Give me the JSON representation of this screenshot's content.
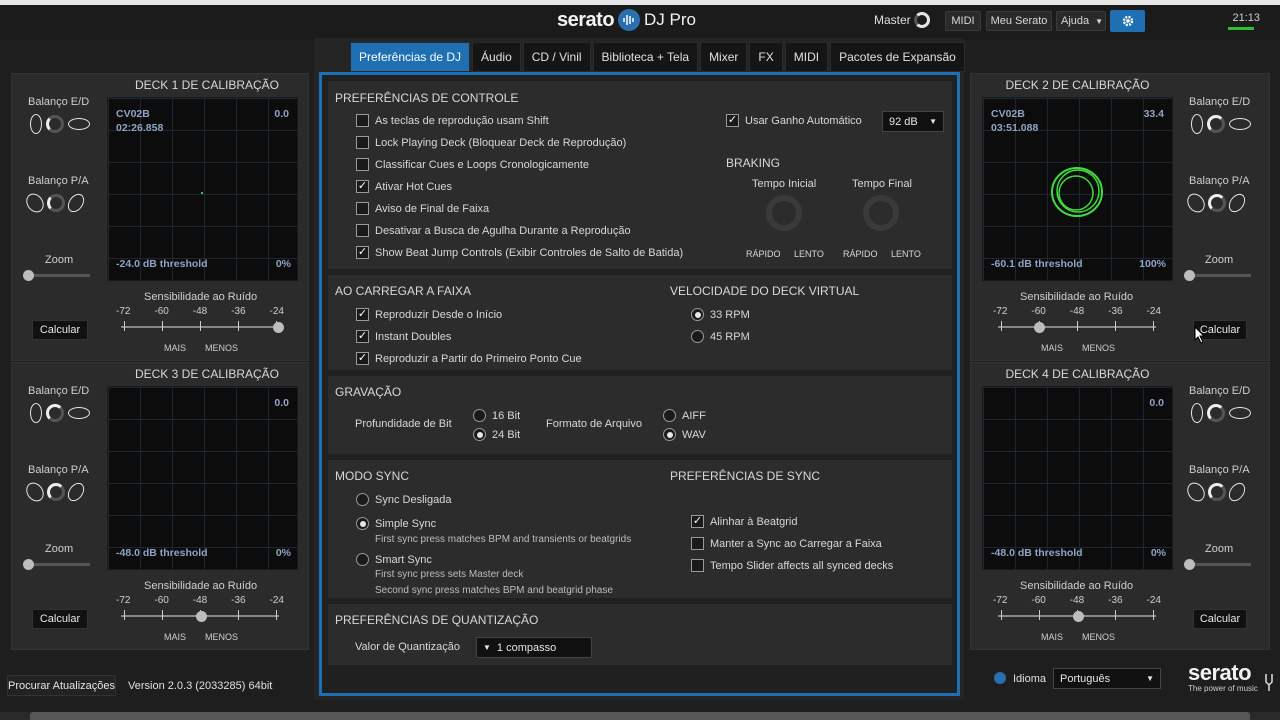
{
  "header": {
    "logo_word": "serato",
    "logo_sub": "DJ Pro",
    "master_label": "Master",
    "midi_button": "MIDI",
    "my_serato_button": "Meu Serato",
    "help_button": "Ajuda",
    "clock": "21:13"
  },
  "tabs": [
    {
      "label": "Preferências de DJ",
      "active": true
    },
    {
      "label": "Áudio"
    },
    {
      "label": "CD / Vinil"
    },
    {
      "label": "Biblioteca + Tela"
    },
    {
      "label": "Mixer"
    },
    {
      "label": "FX"
    },
    {
      "label": "MIDI"
    },
    {
      "label": "Pacotes de Expansão"
    }
  ],
  "decks": {
    "d1": {
      "title": "DECK 1 DE CALIBRAÇÃO",
      "track": "CV02B",
      "time": "02:26.858",
      "value": "0.0",
      "threshold": "-24.0 dB threshold",
      "percent": "0%",
      "noise_level": -24
    },
    "d2": {
      "title": "DECK 2 DE CALIBRAÇÃO",
      "track": "CV02B",
      "time": "03:51.088",
      "value": "33.4",
      "threshold": "-60.1 dB threshold",
      "percent": "100%",
      "noise_level": -60
    },
    "d3": {
      "title": "DECK 3 DE CALIBRAÇÃO",
      "value": "0.0",
      "threshold": "-48.0 dB threshold",
      "percent": "0%",
      "noise_level": -48
    },
    "d4": {
      "title": "DECK 4 DE CALIBRAÇÃO",
      "value": "0.0",
      "threshold": "-48.0 dB threshold",
      "percent": "0%",
      "noise_level": -48
    }
  },
  "deck_labels": {
    "balance_lr": "Balanço E/D",
    "balance_pa": "Balanço P/A",
    "zoom": "Zoom",
    "noise": "Sensibilidade ao Ruído",
    "calc": "Calcular",
    "more": "MAIS",
    "less": "MENOS",
    "ticks": [
      "-72",
      "-60",
      "-48",
      "-36",
      "-24"
    ]
  },
  "control": {
    "title": "PREFERÊNCIAS DE CONTROLE",
    "items": [
      {
        "label": "As teclas de reprodução usam Shift",
        "checked": false
      },
      {
        "label": "Lock Playing Deck (Bloquear Deck de Reprodução)",
        "checked": false
      },
      {
        "label": "Classificar Cues e Loops Cronologicamente",
        "checked": false
      },
      {
        "label": "Ativar Hot Cues",
        "checked": true
      },
      {
        "label": "Aviso de Final de Faixa",
        "checked": false
      },
      {
        "label": "Desativar a Busca de Agulha Durante a Reprodução",
        "checked": false
      },
      {
        "label": "Show Beat Jump Controls (Exibir Controles de Salto de Batida)",
        "checked": true
      }
    ],
    "auto_gain_label": "Usar Ganho Automático",
    "auto_gain_checked": true,
    "auto_gain_value": "92 dB",
    "braking_title": "BRAKING",
    "brake_start": "Tempo Inicial",
    "brake_end": "Tempo Final",
    "fast": "RÁPIDO",
    "slow": "LENTO"
  },
  "load": {
    "title": "AO CARREGAR A FAIXA",
    "items": [
      {
        "label": "Reproduzir Desde o Início",
        "checked": true
      },
      {
        "label": "Instant Doubles",
        "checked": true
      },
      {
        "label": "Reproduzir a Partir do Primeiro Ponto Cue",
        "checked": true
      }
    ],
    "virtual_title": "VELOCIDADE DO DECK VIRTUAL",
    "rpm": [
      {
        "label": "33 RPM",
        "selected": true
      },
      {
        "label": "45 RPM",
        "selected": false
      }
    ]
  },
  "recording": {
    "title": "GRAVAÇÃO",
    "bit_depth_label": "Profundidade de Bit",
    "bits": [
      {
        "label": "16 Bit",
        "selected": false
      },
      {
        "label": "24 Bit",
        "selected": true
      }
    ],
    "format_label": "Formato de Arquivo",
    "formats": [
      {
        "label": "AIFF",
        "selected": false
      },
      {
        "label": "WAV",
        "selected": true
      }
    ]
  },
  "sync": {
    "title": "MODO SYNC",
    "modes": [
      {
        "label": "Sync Desligada",
        "selected": false
      },
      {
        "label": "Simple Sync",
        "selected": true,
        "note1": "First sync press matches BPM and transients or beatgrids"
      },
      {
        "label": "Smart Sync",
        "selected": false,
        "note1": "First sync press sets Master deck",
        "note2": "Second sync press matches BPM and beatgrid phase"
      }
    ],
    "pref_title": "PREFERÊNCIAS DE SYNC",
    "prefs": [
      {
        "label": "Alinhar à Beatgrid",
        "checked": true
      },
      {
        "label": "Manter a Sync ao Carregar a Faixa",
        "checked": false
      },
      {
        "label": "Tempo Slider affects all synced decks",
        "checked": false
      }
    ]
  },
  "quant": {
    "title": "PREFERÊNCIAS DE QUANTIZAÇÃO",
    "label": "Valor de Quantização",
    "value": "1 compasso"
  },
  "footer": {
    "update_button": "Procurar Atualizações",
    "version": "Version 2.0.3 (2033285) 64bit",
    "language_label": "Idioma",
    "language_value": "Português",
    "brand": "serato",
    "tagline": "The power of music"
  }
}
